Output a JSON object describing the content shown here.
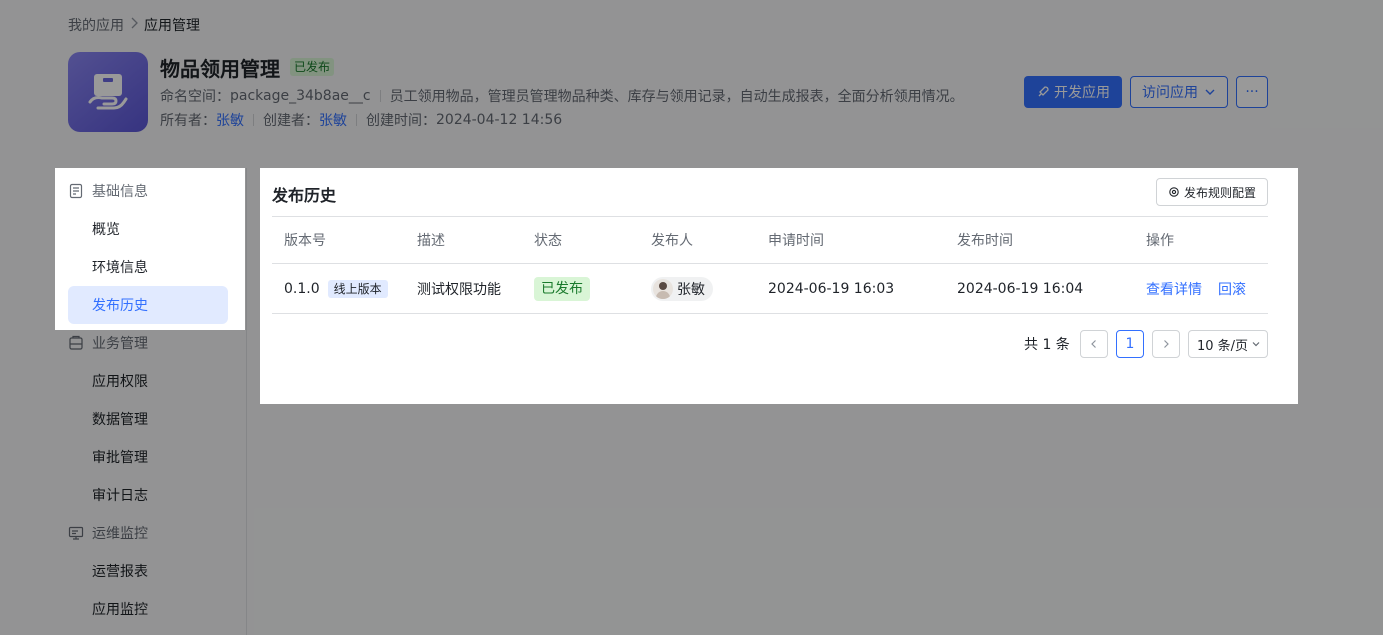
{
  "breadcrumb": {
    "items": [
      "我的应用"
    ],
    "current": "应用管理"
  },
  "app": {
    "title": "物品领用管理",
    "status": "已发布",
    "namespace_label": "命名空间：",
    "namespace": "package_34b8ae__c",
    "description": "员工领用物品，管理员管理物品种类、库存与领用记录，自动生成报表，全面分析领用情况。",
    "owner_label": "所有者：",
    "owner": "张敏",
    "creator_label": "创建者：",
    "creator": "张敏",
    "created_label": "创建时间：",
    "created": "2024-04-12 14:56"
  },
  "actions": {
    "develop": "开发应用",
    "visit": "访问应用",
    "more": "···"
  },
  "sidebar": {
    "groups": [
      {
        "label": "基础信息",
        "icon": "document-icon",
        "items": [
          "概览",
          "环境信息",
          "发布历史"
        ]
      },
      {
        "label": "业务管理",
        "icon": "briefcase-icon",
        "items": [
          "应用权限",
          "数据管理",
          "审批管理",
          "审计日志"
        ]
      },
      {
        "label": "运维监控",
        "icon": "monitor-icon",
        "items": [
          "运营报表",
          "应用监控"
        ]
      }
    ],
    "active": "发布历史"
  },
  "panel": {
    "title": "发布历史",
    "rule_button": "发布规则配置",
    "columns": [
      "版本号",
      "描述",
      "状态",
      "发布人",
      "申请时间",
      "发布时间",
      "操作"
    ],
    "rows": [
      {
        "version": "0.1.0",
        "version_tag": "线上版本",
        "description": "测试权限功能",
        "status": "已发布",
        "publisher": "张敏",
        "applied_at": "2024-06-19 16:03",
        "published_at": "2024-06-19 16:04",
        "op_detail": "查看详情",
        "op_rollback": "回滚"
      }
    ],
    "pagination": {
      "total": "共 1 条",
      "current_page": "1",
      "page_size": "10 条/页"
    }
  },
  "colors": {
    "accent": "#3370ff",
    "success_bg": "#d9f5d6",
    "success_text": "#1a7a2c"
  }
}
